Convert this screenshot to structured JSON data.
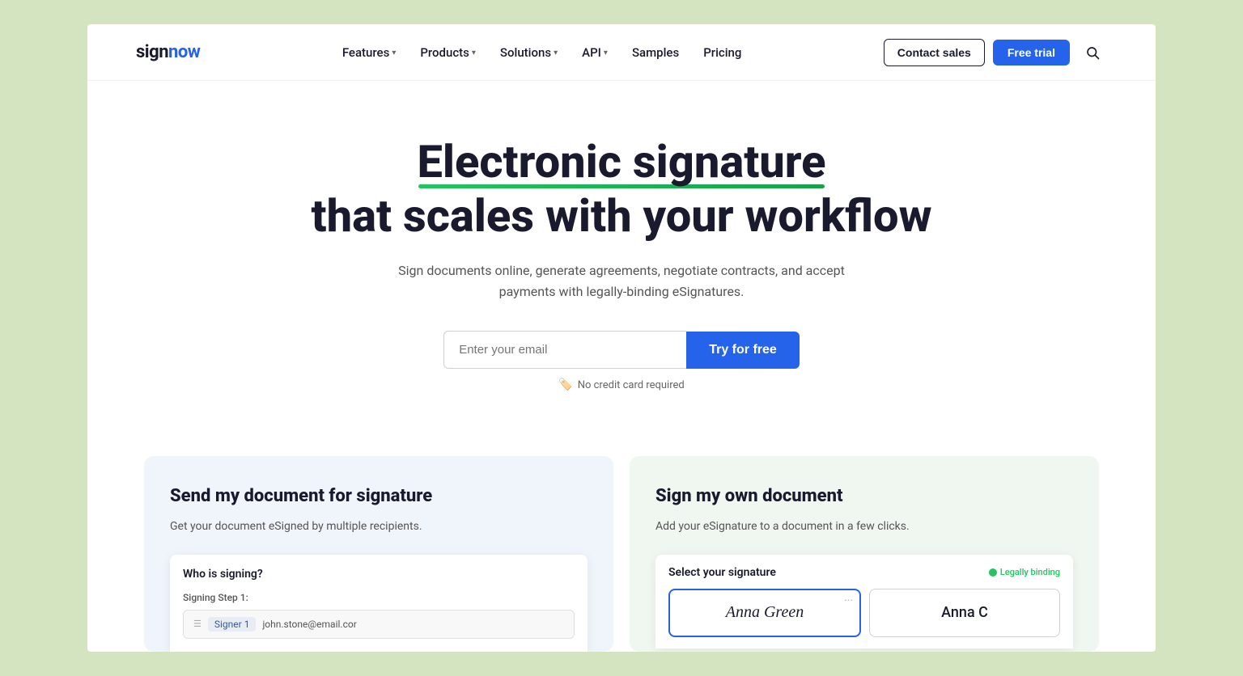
{
  "page": {
    "background_color": "#d4e4c0"
  },
  "header": {
    "logo_text": "sign",
    "logo_accent": "now",
    "nav_items": [
      {
        "label": "Features",
        "has_dropdown": true
      },
      {
        "label": "Products",
        "has_dropdown": true
      },
      {
        "label": "Solutions",
        "has_dropdown": true
      },
      {
        "label": "API",
        "has_dropdown": true
      },
      {
        "label": "Samples",
        "has_dropdown": false
      },
      {
        "label": "Pricing",
        "has_dropdown": false
      }
    ],
    "contact_sales_label": "Contact sales",
    "free_trial_label": "Free trial"
  },
  "hero": {
    "title_line1": "Electronic signature",
    "title_line2": "that scales with your workflow",
    "subtitle": "Sign documents online, generate agreements, negotiate contracts, and accept payments with legally-binding eSignatures.",
    "email_placeholder": "Enter your email",
    "try_free_label": "Try for free",
    "no_credit_card_text": "No credit card required"
  },
  "feature_cards": [
    {
      "title": "Send my document for signature",
      "description": "Get your document eSigned by multiple recipients.",
      "mock_title": "Who is signing?",
      "step_label": "Signing Step 1:",
      "signer_label": "Signer 1",
      "signer_email": "john.stone@email.cor"
    },
    {
      "title": "Sign my own document",
      "description": "Add your eSignature to a document in a few clicks.",
      "mock_title": "Select your signature",
      "legal_badge": "Legally binding",
      "sig1": "Anna Green",
      "sig2": "Anna C"
    }
  ]
}
